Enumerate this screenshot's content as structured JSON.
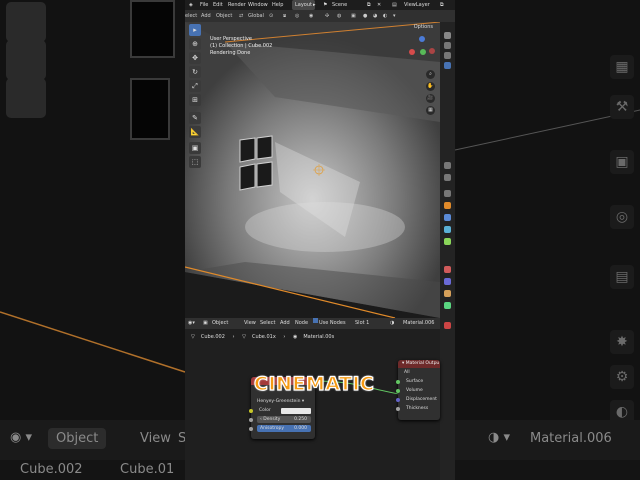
{
  "menu": {
    "file": "File",
    "edit": "Edit",
    "render": "Render",
    "window": "Window",
    "help": "Help",
    "workspace_tab": "Layout",
    "scene": "Scene",
    "view_layer": "ViewLayer"
  },
  "viewport_header": {
    "select": "elect",
    "add": "Add",
    "object": "Object",
    "transform": "Global",
    "options": "Options"
  },
  "viewport_info": {
    "perspective": "User Perspective",
    "collection": "(1) Collection | Cube.002",
    "status": "Rendering Done"
  },
  "node_editor_header": {
    "mode": "Object",
    "view": "View",
    "select": "Select",
    "add": "Add",
    "node": "Node",
    "use_nodes": "Use Nodes",
    "slot": "Slot 1",
    "material": "Material.006"
  },
  "breadcrumb": [
    "Cube.002",
    "Cube.01x",
    "Material.00s"
  ],
  "volume_node": {
    "phase": "Henyey-Greenstein",
    "color_label": "Color",
    "density_label": "Density",
    "density_value": "0.250",
    "anisotropy_label": "Anisotropy",
    "anisotropy_value": "0.000"
  },
  "material_output_node": {
    "title": "Material Outpu",
    "target": "All",
    "sockets": [
      "Surface",
      "Volume",
      "Displacement",
      "Thickness"
    ]
  },
  "overlay_caption": "CINEMATIC",
  "background": {
    "mode": "Object",
    "view": "View",
    "s": "S",
    "material": "Material.006",
    "object": "Cube.002",
    "object2": "Cube.01"
  },
  "colors": {
    "accent_blue": "#4772b3",
    "caption_orange": "#f59a12",
    "edge_orange": "#e08a2a",
    "socket_yellow": "#c7c729",
    "socket_green": "#63c763",
    "volume_header_red": "#a33a3a",
    "output_header_red": "#6e2a2a"
  }
}
